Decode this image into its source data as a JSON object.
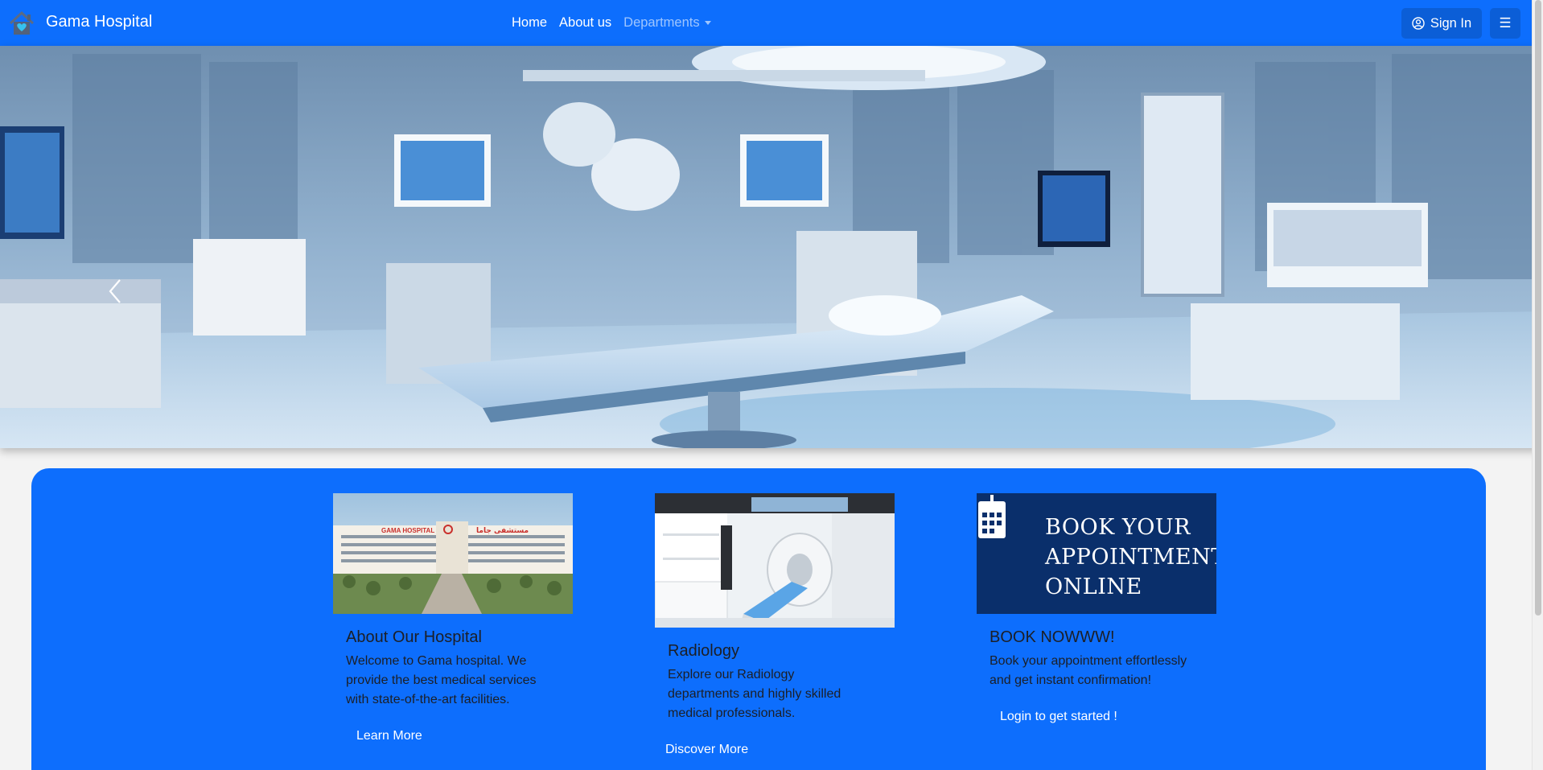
{
  "navbar": {
    "brand": "Gama Hospital",
    "links": [
      {
        "label": "Home"
      },
      {
        "label": "About us"
      },
      {
        "label": "Departments"
      }
    ],
    "signin_label": "Sign In",
    "menu_icon": "☰"
  },
  "hero": {
    "carousel_prev_icon": "chevron-left-icon"
  },
  "cards": [
    {
      "title": "About Our Hospital",
      "text": "Welcome to Gama hospital. We provide the best medical services with state-of-the-art facilities.",
      "button": "Learn More",
      "image_sign_left": "GAMA HOSPITAL",
      "image_sign_right": "مستشفى جاما"
    },
    {
      "title": "Radiology",
      "text": "Explore our Radiology departments and highly skilled medical professionals.",
      "button": "Discover More"
    },
    {
      "title": "BOOK NOWWW!",
      "text": "Book your appointment effortlessly and get instant confirmation!",
      "button": "Login to get started !",
      "banner_lines": [
        "BOOK YOUR",
        "APPOINTMENT",
        "ONLINE"
      ]
    }
  ],
  "colors": {
    "primary": "#0d6efd",
    "banner_bg": "#0a2f6b"
  }
}
